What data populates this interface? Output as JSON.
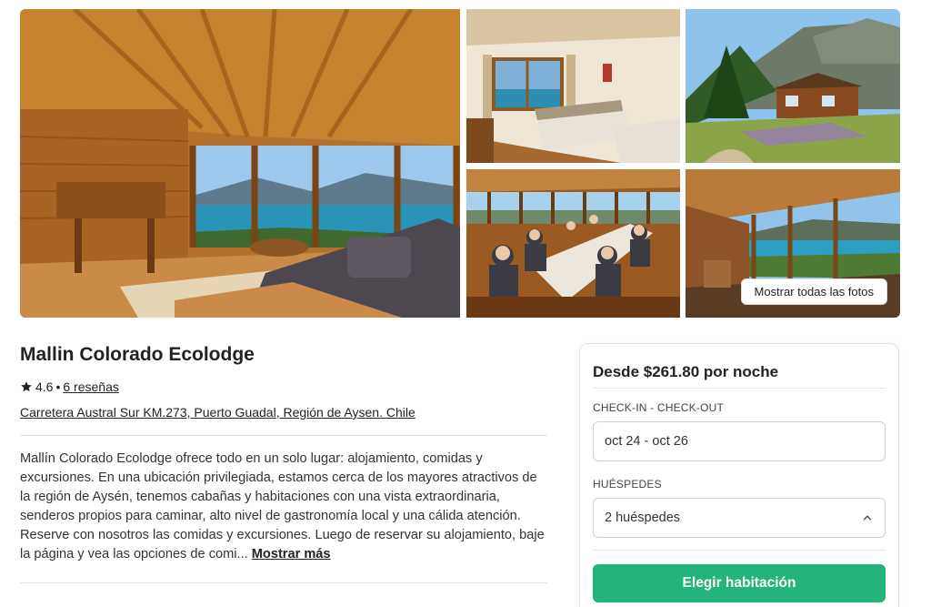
{
  "gallery": {
    "show_all_label": "Mostrar todas las fotos",
    "photos": [
      "cabin-living-room-lake-view",
      "bedroom-window-lake",
      "cabin-exterior-hillside",
      "dining-room-guests",
      "veranda-lake-view"
    ]
  },
  "listing": {
    "title": "Mallin Colorado Ecolodge",
    "rating": "4.6",
    "rating_separator": "•",
    "reviews_label": "6 reseñas",
    "address": "Carretera Austral Sur KM.273, Puerto Guadal, Región de Aysen. Chile",
    "description": "Mallín Colorado Ecolodge ofrece todo en un solo lugar: alojamiento, comidas y excursiones. En una ubicación privilegiada, estamos cerca de los mayores atractivos de la región de Aysén, tenemos cabañas y habitaciones con una vista extraordinaria, senderos propios para caminar, alto nivel de gastronomía local y una cálida atención. Reserve con nosotros las comidas y excursiones. Luego de reservar su alojamiento, baje la página y vea las opciones de comi...",
    "show_more_label": "Mostrar más"
  },
  "booking": {
    "price_label": "Desde $261.80 por noche",
    "dates_label": "CHECK-IN - CHECK-OUT",
    "dates_value": "oct 24 - oct 26",
    "guests_label": "HUÉSPEDES",
    "guests_value": "2 huéspedes",
    "cta_label": "Elegir habitación",
    "cta_color": "#22b47a"
  }
}
